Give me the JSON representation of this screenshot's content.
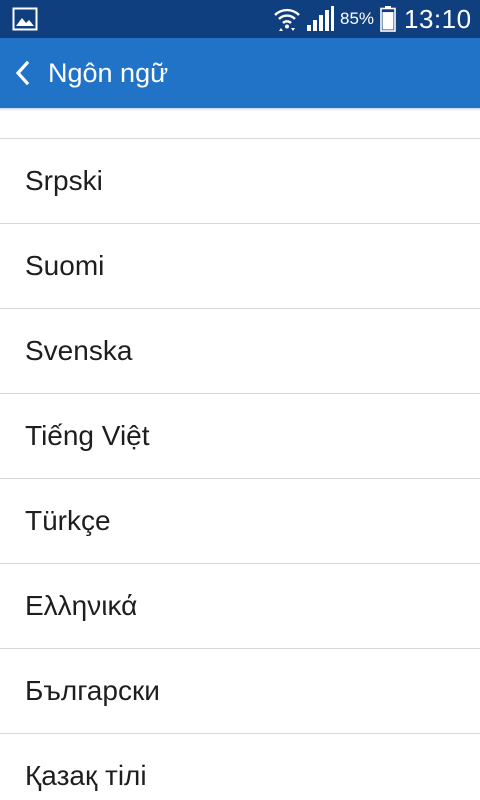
{
  "status_bar": {
    "battery_percent": "85%",
    "time": "13:10",
    "icons": {
      "notification": "image-icon",
      "wifi": "wifi-icon",
      "signal": "signal-icon",
      "battery": "battery-icon"
    },
    "battery_level": 0.85
  },
  "app_bar": {
    "title": "Ngôn ngữ",
    "back_icon": "chevron-left-icon"
  },
  "languages": [
    "Srpski",
    "Suomi",
    "Svenska",
    "Tiếng Việt",
    "Türkçe",
    "Ελληνικά",
    "Български",
    "Қазақ тілі"
  ],
  "colors": {
    "status_bar": "#0f3f7f",
    "app_bar": "#2073c7",
    "divider": "#d6d6d6",
    "text": "#1e1e1e"
  }
}
